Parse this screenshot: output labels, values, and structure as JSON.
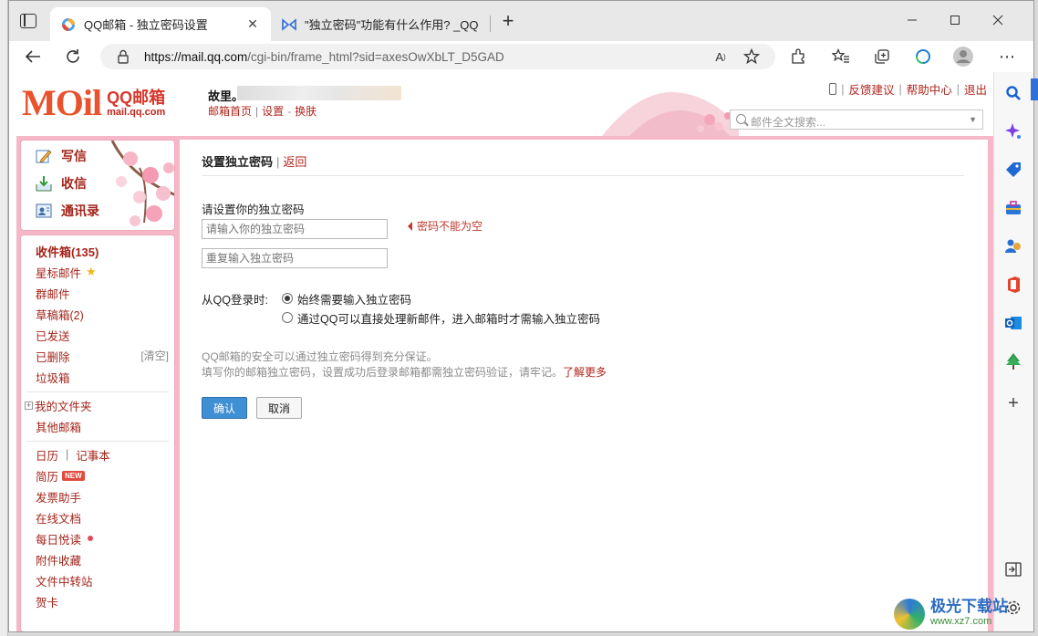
{
  "browser": {
    "tabs": [
      {
        "title": "QQ邮箱 - 独立密码设置",
        "active": true
      },
      {
        "title": "\"独立密码\"功能有什么作用? _QQ",
        "active": false
      }
    ],
    "url_host": "https://mail.qq.com",
    "url_rest": "/cgi-bin/frame_html?sid=axesOwXbLT_D5GAD"
  },
  "header": {
    "logo_text": "MOil",
    "brand": "QQ邮箱",
    "domain": "mail.qq.com",
    "user_name": "故里。",
    "user_links": [
      "邮箱首页",
      "设置",
      "换肤"
    ],
    "top_links": [
      "反馈建议",
      "帮助中心",
      "退出"
    ],
    "search_placeholder": "邮件全文搜索..."
  },
  "actions": [
    "写信",
    "收信",
    "通讯录"
  ],
  "folders": {
    "inbox": "收件箱(135)",
    "starred": "星标邮件",
    "group": "群邮件",
    "drafts": "草稿箱(2)",
    "sent": "已发送",
    "deleted": "已删除",
    "clear": "[清空]",
    "trash": "垃圾箱",
    "my_folders": "我的文件夹",
    "other_mailbox": "其他邮箱",
    "calendar": "日历",
    "notes": "记事本",
    "resume": "简历",
    "new_badge": "NEW",
    "invoice": "发票助手",
    "online_docs": "在线文档",
    "daily_read": "每日悦读",
    "attachments": "附件收藏",
    "file_transfer": "文件中转站",
    "card": "贺卡"
  },
  "main": {
    "title": "设置独立密码",
    "back": "返回",
    "set_label": "请设置你的独立密码",
    "pwd_placeholder": "请输入你的独立密码",
    "pwd_repeat_placeholder": "重复输入独立密码",
    "error": "密码不能为空",
    "login_label": "从QQ登录时:",
    "radio_always": "始终需要输入独立密码",
    "radio_direct": "通过QQ可以直接处理新邮件，进入邮箱时才需输入独立密码",
    "radio_selected": "always",
    "note1": "QQ邮箱的安全可以通过独立密码得到充分保证。",
    "note2": "填写你的邮箱独立密码，设置成功后登录邮箱都需独立密码验证，请牢记。",
    "learn_more": "了解更多",
    "confirm": "确认",
    "cancel": "取消"
  },
  "watermark": {
    "cn": "极光下载站",
    "en": "www.xz7.com"
  },
  "colors": {
    "accent_red": "#b1251d",
    "pink_frame": "#f6b7c8",
    "button_blue": "#3f8fd4"
  }
}
